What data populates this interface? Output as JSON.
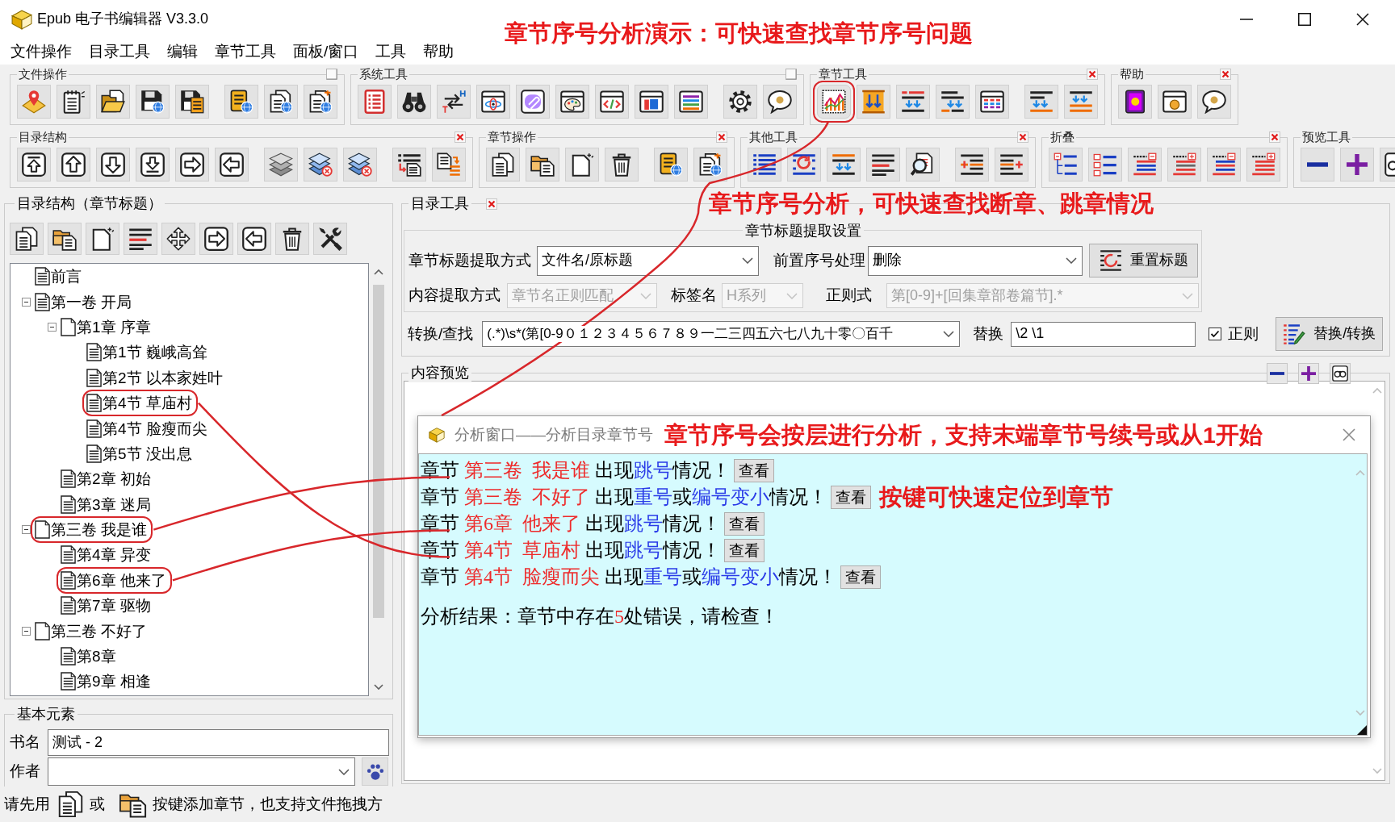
{
  "window": {
    "title": "Epub 电子书编辑器 V3.3.0",
    "annotation": "章节序号分析演示：可快速查找章节序号问题"
  },
  "menu": [
    "文件操作",
    "目录工具",
    "编辑",
    "章节工具",
    "面板/窗口",
    "工具",
    "帮助"
  ],
  "toolbars": [
    {
      "groups": [
        {
          "title": "文件操作",
          "toggle": true,
          "closable": false,
          "circled": false
        },
        {
          "title": "系统工具",
          "toggle": true,
          "closable": false,
          "circled": false
        },
        {
          "title": "章节工具",
          "toggle": false,
          "closable": true,
          "circled": true
        },
        {
          "title": "帮助",
          "toggle": false,
          "closable": true,
          "circled": false
        }
      ]
    },
    {
      "groups": [
        {
          "title": "目录结构",
          "toggle": false,
          "closable": true,
          "circled": false
        },
        {
          "title": "章节操作",
          "toggle": false,
          "closable": true,
          "circled": false
        },
        {
          "title": "其他工具",
          "toggle": false,
          "closable": true,
          "circled": false
        },
        {
          "title": "折叠",
          "toggle": false,
          "closable": true,
          "circled": false
        },
        {
          "title": "预览工具",
          "toggle": false,
          "closable": false,
          "circled": false
        }
      ]
    }
  ],
  "tree_panel": {
    "title": "目录结构（章节标题）",
    "items": [
      {
        "label": "前言",
        "kind": "page",
        "circled": false
      },
      {
        "label": "第一卷 开局",
        "kind": "page",
        "circled": false,
        "expanded": true,
        "children": [
          {
            "label": "第1章 序章",
            "kind": "blank",
            "circled": false,
            "expanded": true,
            "children": [
              {
                "label": "第1节 巍峨高耸",
                "kind": "page",
                "circled": false
              },
              {
                "label": "第2节 以本家姓叶",
                "kind": "page",
                "circled": false
              },
              {
                "label": "第4节 草庙村",
                "kind": "page",
                "circled": true
              },
              {
                "label": "第4节 脸瘦而尖",
                "kind": "page",
                "circled": false
              },
              {
                "label": "第5节 没出息",
                "kind": "page",
                "circled": false
              }
            ]
          },
          {
            "label": "第2章 初始",
            "kind": "page",
            "circled": false
          },
          {
            "label": "第3章 迷局",
            "kind": "page",
            "circled": false
          }
        ]
      },
      {
        "label": "第三卷 我是谁",
        "kind": "blank",
        "circled": true,
        "expanded": true,
        "children": [
          {
            "label": "第4章 异变",
            "kind": "page",
            "circled": false
          },
          {
            "label": "第6章 他来了",
            "kind": "page",
            "circled": true
          },
          {
            "label": "第7章 驱物",
            "kind": "page",
            "circled": false
          }
        ]
      },
      {
        "label": "第三卷 不好了",
        "kind": "blank",
        "circled": false,
        "expanded": true,
        "children": [
          {
            "label": "第8章",
            "kind": "page",
            "circled": false
          },
          {
            "label": "第9章 相逢",
            "kind": "page",
            "circled": false
          }
        ]
      }
    ]
  },
  "basic_elements": {
    "title": "基本元素",
    "fields": [
      {
        "label": "书名",
        "kind": "text",
        "value": "测试 - 2",
        "disabled": false
      },
      {
        "label": "作者",
        "kind": "select",
        "disabled": false
      }
    ]
  },
  "status_bar": {
    "lead": "请先用",
    "middle": "或",
    "tail": "按键添加章节，也支持文件拖拽方"
  },
  "catalog_tool": {
    "title": "目录工具",
    "closable": true,
    "annotation": "章节序号分析，可快速查找断章、跳章情况",
    "settings": {
      "title": "章节标题提取设置",
      "rows": [
        {
          "fields": [
            {
              "label": "章节标题提取方式",
              "kind": "select",
              "value": "文件名/原标题",
              "disabled": false
            },
            {
              "label": "前置序号处理",
              "kind": "select",
              "value": "删除",
              "disabled": false
            },
            {
              "label": "重置标题",
              "kind": "button",
              "disabled": false
            }
          ]
        },
        {
          "fields": [
            {
              "label": "内容提取方式",
              "kind": "select",
              "value": "章节名正则匹配",
              "disabled": true
            },
            {
              "label": "标签名",
              "kind": "select",
              "value": "H系列",
              "disabled": true
            },
            {
              "label": "正则式",
              "kind": "select",
              "value": "第[0-9]+[回集章部卷篇节].*",
              "disabled": true
            }
          ]
        }
      ]
    },
    "convert_row": [
      {
        "label": "转换/查找",
        "kind": "select",
        "value": "(.*)\\s*(第[0-9０１２３４５６７８９一二三四五六七八九十零〇百千",
        "disabled": false
      },
      {
        "label": "替换",
        "kind": "text",
        "value": "\\2 \\1",
        "disabled": false
      },
      {
        "label": "正则",
        "kind": "checkbox",
        "checked": true
      },
      {
        "label": "替换/转换",
        "kind": "button",
        "disabled": false
      }
    ]
  },
  "preview": {
    "title": "内容预览"
  },
  "analysis_window": {
    "title": "分析窗口——分析目录章节号",
    "annotation": "章节序号会按层进行分析，支持末端章节号续号或从1开始",
    "rows": [
      {
        "segments": [
          {
            "text": "章节 ",
            "color": "#000000"
          },
          {
            "text": "第三卷  我是谁",
            "color": "#ee2b2b"
          },
          {
            "text": " 出现",
            "color": "#000000"
          },
          {
            "text": "跳号",
            "color": "#2a3be8"
          },
          {
            "text": "情况！",
            "color": "#000000"
          }
        ],
        "button": "查看"
      },
      {
        "segments": [
          {
            "text": "章节 ",
            "color": "#000000"
          },
          {
            "text": "第三卷  不好了",
            "color": "#ee2b2b"
          },
          {
            "text": " 出现",
            "color": "#000000"
          },
          {
            "text": "重号",
            "color": "#2a3be8"
          },
          {
            "text": "或",
            "color": "#000000"
          },
          {
            "text": "编号变小",
            "color": "#2a3be8"
          },
          {
            "text": "情况！",
            "color": "#000000"
          }
        ],
        "button": "查看",
        "note": "按键可快速定位到章节"
      },
      {
        "segments": [
          {
            "text": "章节 ",
            "color": "#000000"
          },
          {
            "text": "第6章  他来了",
            "color": "#ee2b2b"
          },
          {
            "text": " 出现",
            "color": "#000000"
          },
          {
            "text": "跳号",
            "color": "#2a3be8"
          },
          {
            "text": "情况！",
            "color": "#000000"
          }
        ],
        "button": "查看"
      },
      {
        "segments": [
          {
            "text": "章节 ",
            "color": "#000000"
          },
          {
            "text": "第4节  草庙村",
            "color": "#ee2b2b"
          },
          {
            "text": " 出现",
            "color": "#000000"
          },
          {
            "text": "跳号",
            "color": "#2a3be8"
          },
          {
            "text": "情况！",
            "color": "#000000"
          }
        ],
        "button": "查看"
      },
      {
        "segments": [
          {
            "text": "章节 ",
            "color": "#000000"
          },
          {
            "text": "第4节  脸瘦而尖",
            "color": "#ee2b2b"
          },
          {
            "text": " 出现",
            "color": "#000000"
          },
          {
            "text": "重号",
            "color": "#2a3be8"
          },
          {
            "text": "或",
            "color": "#000000"
          },
          {
            "text": "编号变小",
            "color": "#2a3be8"
          },
          {
            "text": "情况！",
            "color": "#000000"
          }
        ],
        "button": "查看"
      }
    ],
    "result": {
      "segments": [
        {
          "text": "分析结果：章节中存在",
          "color": "#000000"
        },
        {
          "text": "5",
          "color": "#ee2b2b"
        },
        {
          "text": "处错误，请检查！",
          "color": "#000000"
        }
      ]
    }
  }
}
